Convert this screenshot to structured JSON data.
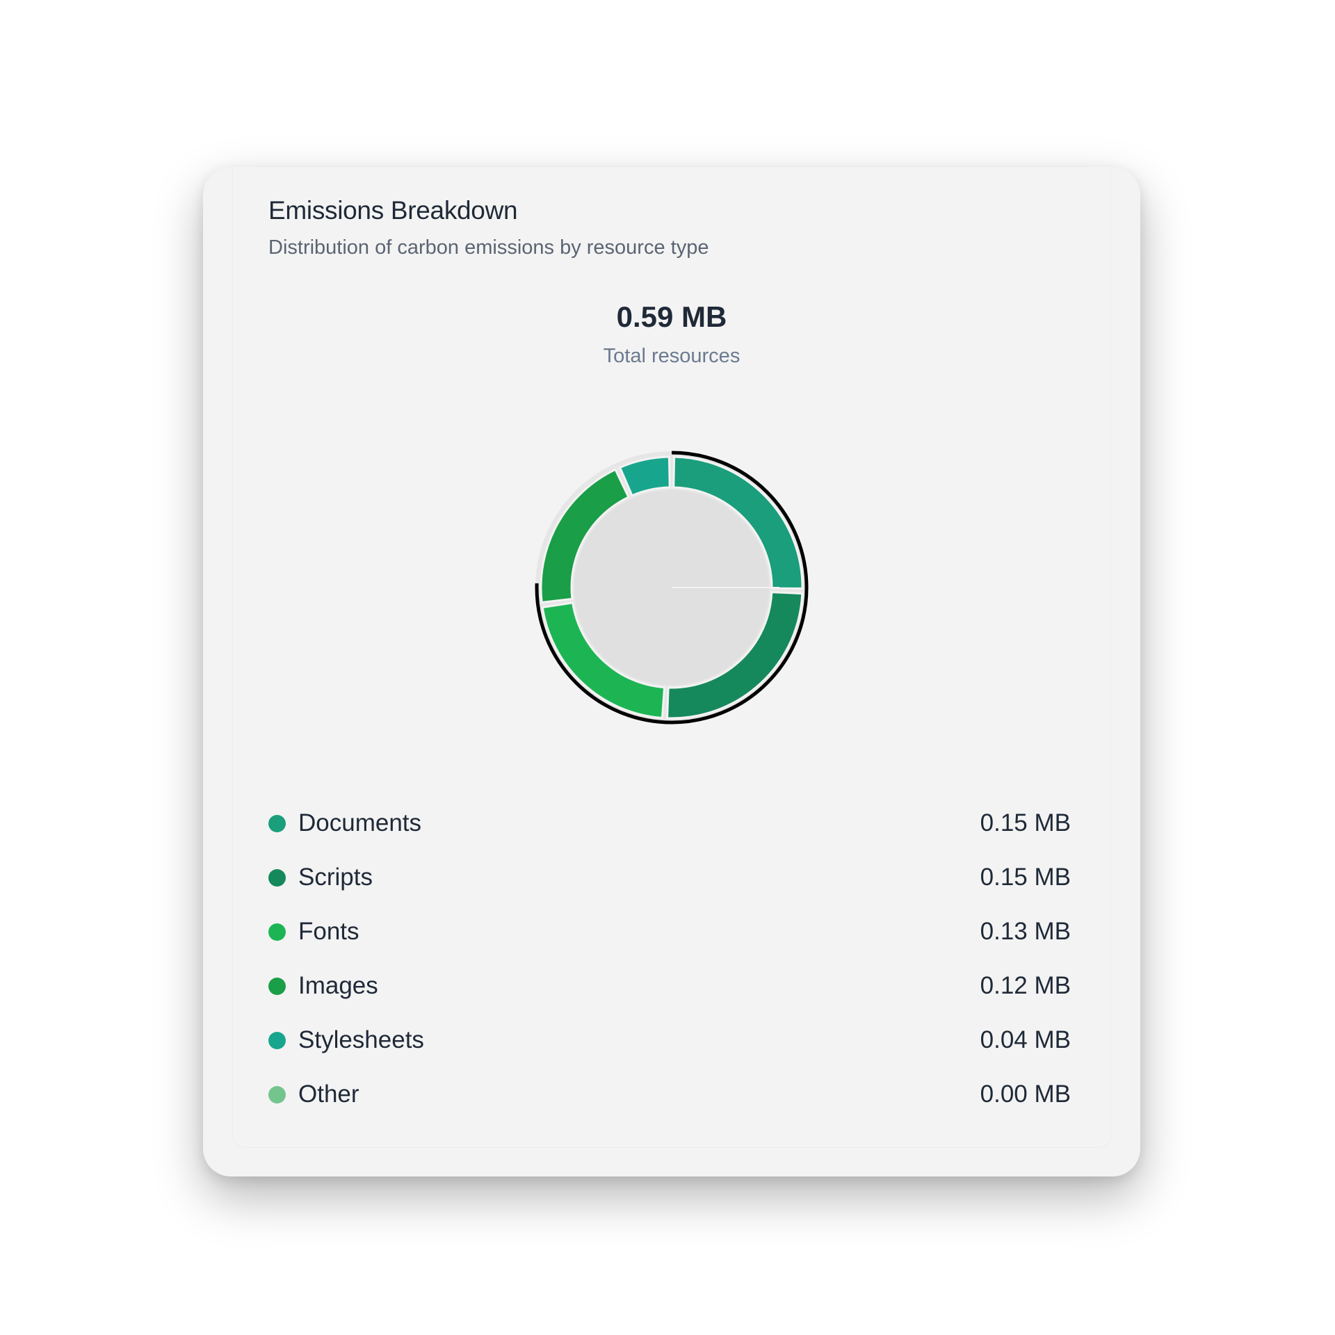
{
  "card": {
    "title": "Emissions Breakdown",
    "subtitle": "Distribution of carbon emissions by resource type"
  },
  "total": {
    "value": "0.59 MB",
    "label": "Total resources"
  },
  "chart_data": {
    "type": "pie",
    "categories": [
      "Documents",
      "Scripts",
      "Fonts",
      "Images",
      "Stylesheets",
      "Other"
    ],
    "values": [
      0.15,
      0.15,
      0.13,
      0.12,
      0.04,
      0.0
    ],
    "colors": [
      "#1a9e7c",
      "#16895c",
      "#1db554",
      "#1a9e47",
      "#17a68d",
      "#74c48e"
    ],
    "unit": "MB"
  },
  "legend": [
    {
      "label": "Documents",
      "value": "0.15 MB",
      "color": "#1a9e7c"
    },
    {
      "label": "Scripts",
      "value": "0.15 MB",
      "color": "#16895c"
    },
    {
      "label": "Fonts",
      "value": "0.13 MB",
      "color": "#1db554"
    },
    {
      "label": "Images",
      "value": "0.12 MB",
      "color": "#1a9e47"
    },
    {
      "label": "Stylesheets",
      "value": "0.04 MB",
      "color": "#17a68d"
    },
    {
      "label": "Other",
      "value": "0.00 MB",
      "color": "#74c48e"
    }
  ]
}
